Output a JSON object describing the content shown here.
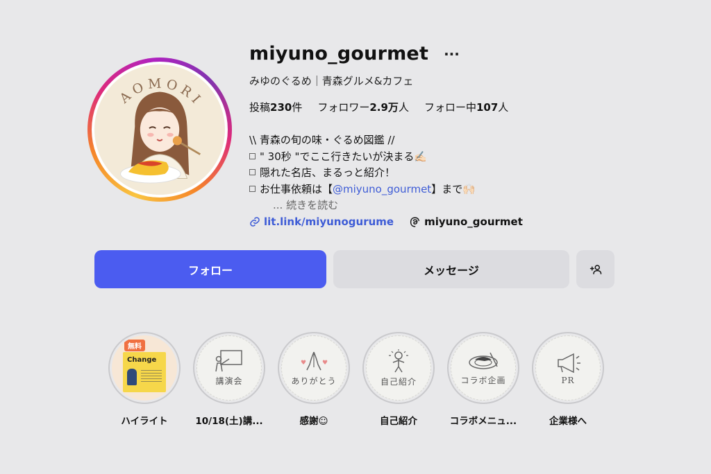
{
  "profile": {
    "username": "miyuno_gourmet",
    "more_label": "···",
    "full_name": "みゆのぐるめ｜青森グルメ&カフェ",
    "avatar_text": "AOMORI",
    "stats": [
      {
        "label": "投稿",
        "value": "230",
        "suffix": "件"
      },
      {
        "label": "フォロワー",
        "value": "2.9万",
        "suffix": "人"
      },
      {
        "label": "フォロー中",
        "value": "107",
        "suffix": "人"
      }
    ],
    "bio": {
      "line1": "\\\\ 青森の旬の味・ぐるめ図鑑 //",
      "line2": "\" 30秒 \"でここ行きたいが決まる✍🏻",
      "line3": "隠れた名店、まるっと紹介！",
      "line4_pre": "お仕事依頼は【",
      "line4_mention": "@miyuno_gourmet",
      "line4_post": "】まで🙌🏻",
      "more": "... 続きを読む"
    },
    "link_url": "lit.link/miyunogurume",
    "threads_handle": "miyuno_gourmet"
  },
  "actions": {
    "follow": "フォロー",
    "message": "メッセージ"
  },
  "highlights": [
    {
      "label": "ハイライト",
      "badge": "無料",
      "card_title": "Change",
      "icon": "event-flyer"
    },
    {
      "label": "10/18(土)講...",
      "caption": "講演会",
      "icon": "lecture-icon"
    },
    {
      "label": "感謝☺︎",
      "caption": "ありがとう",
      "icon": "praying-hands-icon"
    },
    {
      "label": "自己紹介",
      "caption": "自己紹介",
      "icon": "person-icon"
    },
    {
      "label": "コラボメニュ...",
      "caption": "コラボ企画",
      "icon": "plate-icon"
    },
    {
      "label": "企業様へ",
      "caption": "PR",
      "icon": "megaphone-icon"
    }
  ],
  "colors": {
    "follow_button": "#4b5cf0",
    "secondary_button": "#dcdce0",
    "link": "#3e5cd6",
    "background": "#e8e8ea"
  }
}
